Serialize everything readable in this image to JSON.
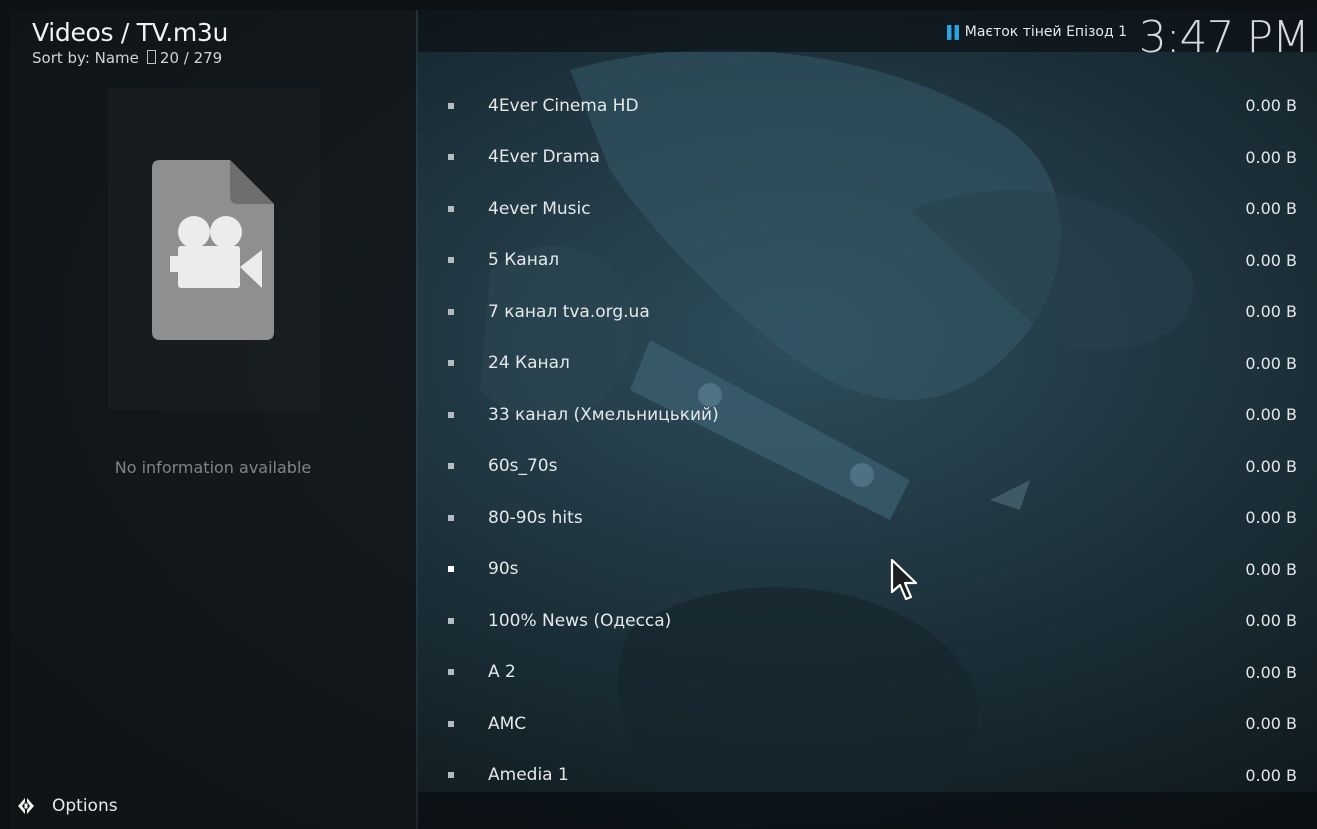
{
  "header": {
    "title": "Videos / TV.m3u",
    "sort_label": "Sort by: Name",
    "count": "20 / 279"
  },
  "info_panel": {
    "icon": "video-file-icon",
    "no_info_text": "No information available"
  },
  "footer": {
    "options_label": "Options",
    "options_icon": "options-diamond-icon"
  },
  "top_bar": {
    "now_playing": "Маєток тіней Епізод 1",
    "now_playing_icon": "pause-icon",
    "clock": "3:47 PM"
  },
  "list": {
    "items": [
      {
        "label": "4Ever Cinema HD",
        "size": "0.00 B"
      },
      {
        "label": "4Ever Drama",
        "size": "0.00 B"
      },
      {
        "label": "4ever Music",
        "size": "0.00 B"
      },
      {
        "label": "5 Канал",
        "size": "0.00 B"
      },
      {
        "label": "7 канал tva.org.ua",
        "size": "0.00 B"
      },
      {
        "label": "24 Канал",
        "size": "0.00 B"
      },
      {
        "label": "33 канал (Хмельницький)",
        "size": "0.00 B"
      },
      {
        "label": "60s_70s",
        "size": "0.00 B"
      },
      {
        "label": "80-90s hits",
        "size": "0.00 B"
      },
      {
        "label": "90s",
        "size": "0.00 B",
        "selected": true
      },
      {
        "label": "100% News (Одесса)",
        "size": "0.00 B"
      },
      {
        "label": "A 2",
        "size": "0.00 B"
      },
      {
        "label": "AMC",
        "size": "0.00 B"
      },
      {
        "label": "Amedia 1",
        "size": "0.00 B"
      }
    ]
  },
  "colors": {
    "accent": "#2aa5e0",
    "text": "#e4e8ea",
    "muted": "#7e8589"
  }
}
